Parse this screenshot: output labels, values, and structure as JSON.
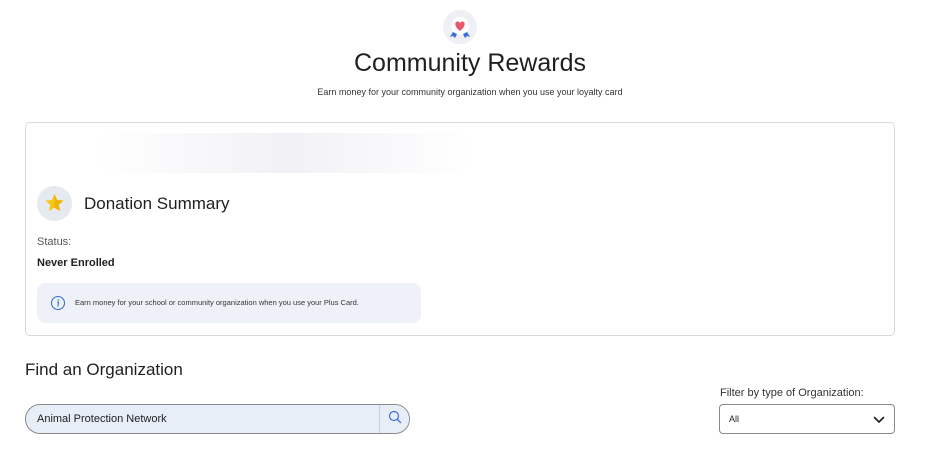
{
  "header": {
    "logo_icon": "heart-ribbon-icon",
    "title": "Community Rewards",
    "subtitle": "Earn money for your community organization when you use your loyalty card"
  },
  "donation_summary": {
    "icon": "star-icon",
    "title": "Donation Summary",
    "status_label": "Status:",
    "status_value": "Never Enrolled",
    "info_icon": "info-icon",
    "info_text": "Earn money for your school or community organization when you use your Plus Card."
  },
  "find_organization": {
    "title": "Find an Organization",
    "search_value": "Animal Protection Network",
    "search_icon": "search-icon",
    "filter_label": "Filter by type of Organization:",
    "filter_value": "All",
    "filter_icon": "chevron-down-icon"
  },
  "colors": {
    "accent_blue": "#3b6fd1",
    "heart_red": "#e8566b",
    "star_yellow": "#f5c518",
    "info_bg": "#eef2f8",
    "search_bg": "#e7eef8"
  }
}
